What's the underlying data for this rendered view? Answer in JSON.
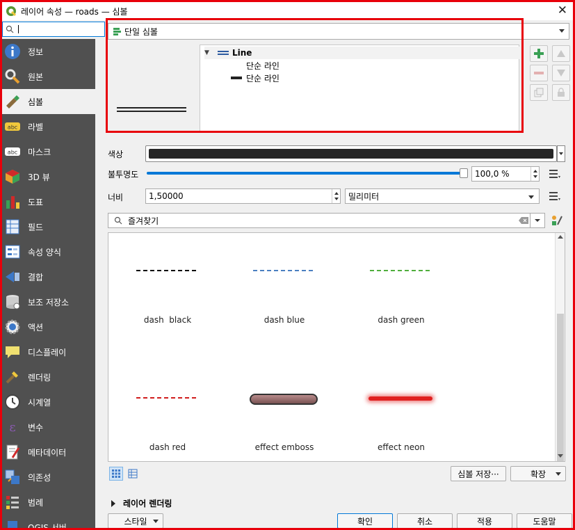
{
  "window": {
    "title": "레이어 속성 — roads — 심볼",
    "close_glyph": "✕"
  },
  "sidebar": {
    "search_placeholder": "",
    "items": [
      {
        "label": "정보",
        "icon": "info-icon"
      },
      {
        "label": "원본",
        "icon": "source-icon"
      },
      {
        "label": "심볼",
        "icon": "symbology-icon",
        "active": true
      },
      {
        "label": "라벨",
        "icon": "labels-icon"
      },
      {
        "label": "마스크",
        "icon": "mask-icon"
      },
      {
        "label": "3D 뷰",
        "icon": "3d-view-icon"
      },
      {
        "label": "도표",
        "icon": "diagram-icon"
      },
      {
        "label": "필드",
        "icon": "fields-icon"
      },
      {
        "label": "속성 양식",
        "icon": "attributes-form-icon"
      },
      {
        "label": "결합",
        "icon": "joins-icon"
      },
      {
        "label": "보조 저장소",
        "icon": "auxiliary-storage-icon"
      },
      {
        "label": "액션",
        "icon": "actions-icon"
      },
      {
        "label": "디스플레이",
        "icon": "display-icon"
      },
      {
        "label": "렌더링",
        "icon": "rendering-icon"
      },
      {
        "label": "시계열",
        "icon": "temporal-icon"
      },
      {
        "label": "변수",
        "icon": "variables-icon"
      },
      {
        "label": "메타데이터",
        "icon": "metadata-icon"
      },
      {
        "label": "의존성",
        "icon": "dependencies-icon"
      },
      {
        "label": "범례",
        "icon": "legend-icon"
      },
      {
        "label": "QGIS 서버",
        "icon": "qgis-server-icon"
      }
    ]
  },
  "renderer": {
    "label": "단일 심볼"
  },
  "symbol_tree": {
    "root": "Line",
    "layers": [
      "단순 라인",
      "단순 라인"
    ]
  },
  "properties": {
    "color_label": "색상",
    "color_value": "#252525",
    "opacity_label": "불투명도",
    "opacity_value": "100,0 %",
    "opacity_level": 1.0,
    "width_label": "너비",
    "width_value": "1,50000",
    "unit_value": "밀리미터"
  },
  "filter": {
    "placeholder": "즐겨찾기"
  },
  "library": {
    "items": [
      {
        "name": "dash  black",
        "style": "dashed",
        "color": "#000000"
      },
      {
        "name": "dash blue",
        "style": "dashed",
        "color": "#4a7fc1"
      },
      {
        "name": "dash green",
        "style": "dashed",
        "color": "#4fae3c"
      },
      {
        "name": "dash red",
        "style": "dashed",
        "color": "#d01c1c"
      },
      {
        "name": "effect emboss",
        "style": "emboss",
        "color": "#b98b8b"
      },
      {
        "name": "effect neon",
        "style": "neon",
        "color": "#e0201f"
      }
    ]
  },
  "actions": {
    "save_symbol": "심볼 저장···",
    "advanced": "확장",
    "layer_rendering": "레이어 렌더링",
    "style": "스타일",
    "ok": "확인",
    "cancel": "취소",
    "apply": "적용",
    "help": "도움말"
  }
}
